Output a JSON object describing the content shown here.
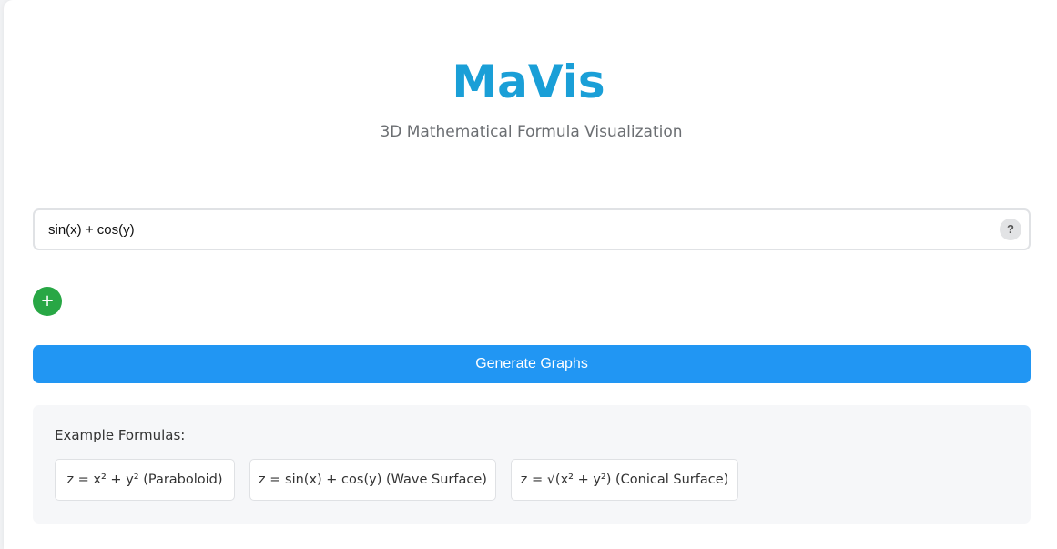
{
  "header": {
    "title": "MaVis",
    "subtitle": "3D Mathematical Formula Visualization"
  },
  "formula": {
    "value": "sin(x) + cos(y)",
    "help_label": "?"
  },
  "actions": {
    "add_label": "+",
    "generate_label": "Generate Graphs"
  },
  "examples": {
    "heading": "Example Formulas:",
    "items": [
      {
        "label": "z = x² + y² (Paraboloid)"
      },
      {
        "label": "z = sin(x) + cos(y) (Wave Surface)"
      },
      {
        "label": "z = √(x² + y²) (Conical Surface)"
      }
    ]
  },
  "colors": {
    "title": "#1a9fd7",
    "add_button": "#28a745",
    "generate_button": "#2196f3",
    "examples_background": "#f6f7f9"
  }
}
